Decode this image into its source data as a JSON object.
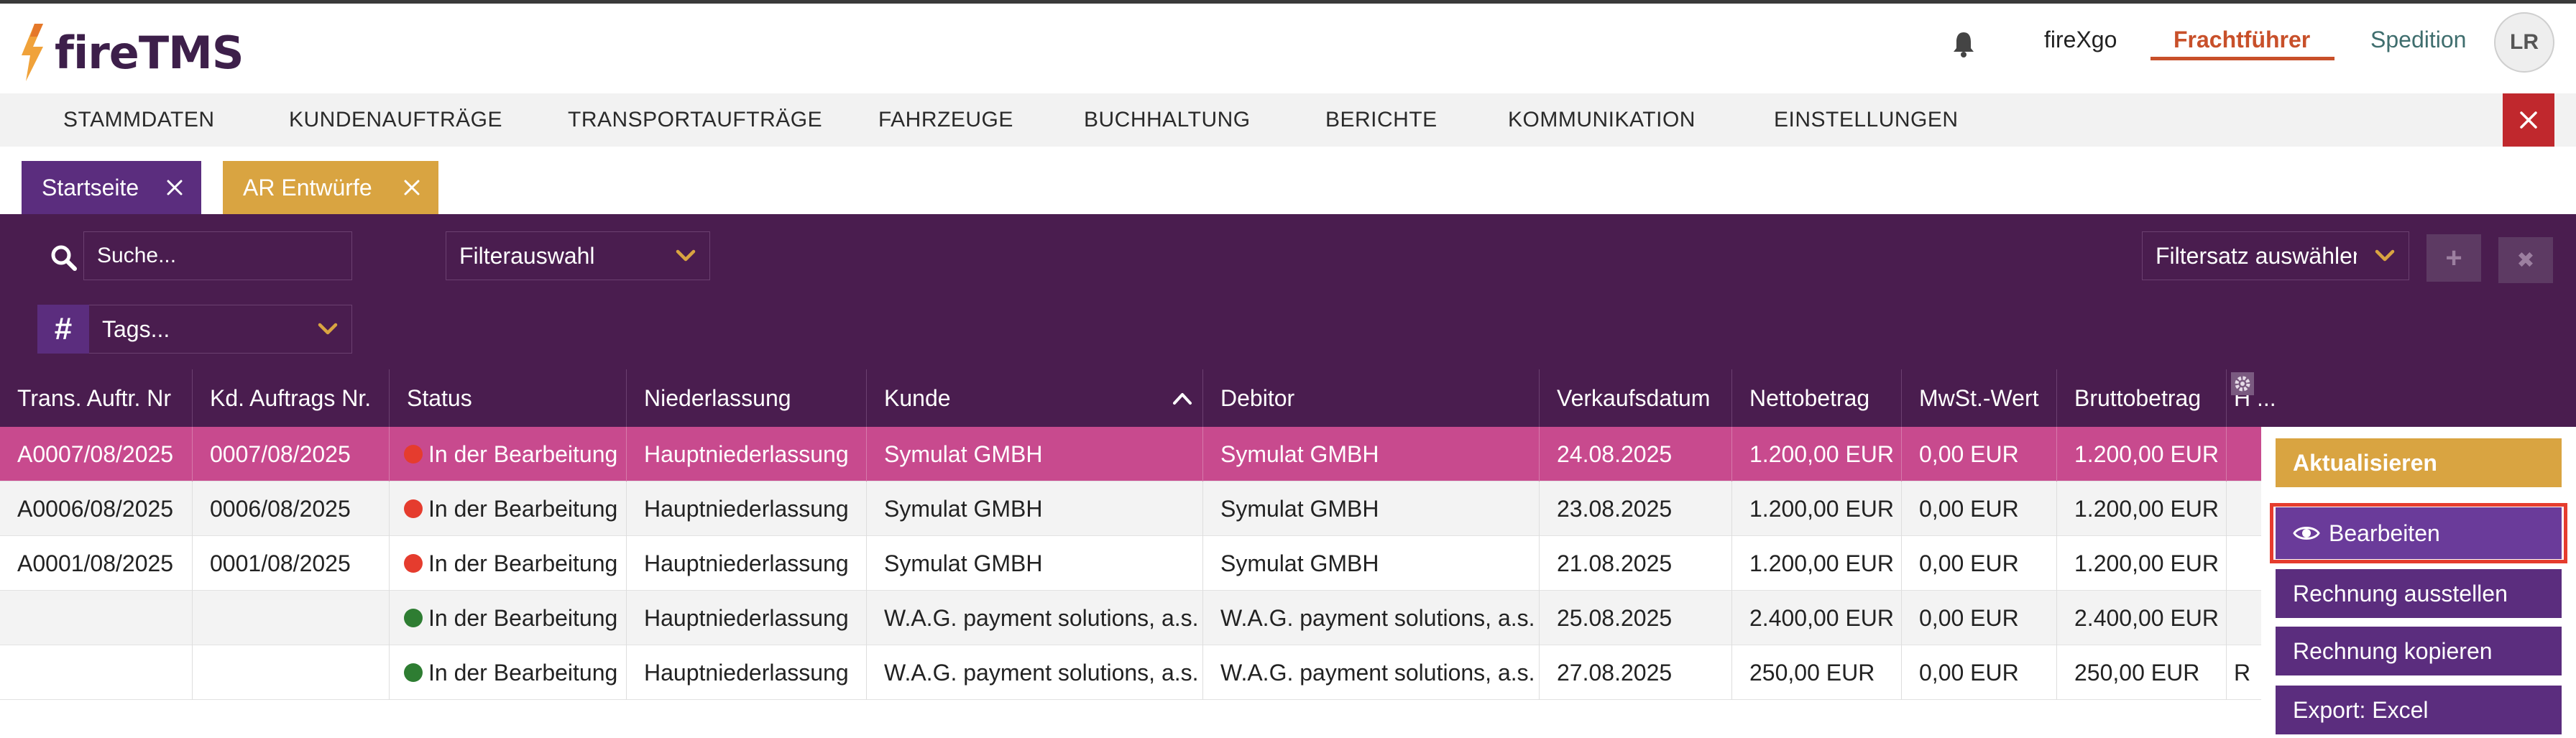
{
  "brand": {
    "name": "fireTMS"
  },
  "header": {
    "links": [
      {
        "label": "fireXgo",
        "active": false
      },
      {
        "label": "Frachtführer",
        "active": true
      },
      {
        "label": "Spedition",
        "active": false
      }
    ],
    "avatar_initials": "LR"
  },
  "nav": {
    "items": [
      "STAMMDATEN",
      "KUNDENAUFTRÄGE",
      "TRANSPORTAUFTRÄGE",
      "FAHRZEUGE",
      "BUCHHALTUNG",
      "BERICHTE",
      "KOMMUNIKATION",
      "EINSTELLUNGEN"
    ]
  },
  "tabs": [
    {
      "label": "Startseite",
      "color": "#5b2d7e"
    },
    {
      "label": "AR Entwürfe",
      "color": "#d9a441"
    }
  ],
  "filters": {
    "search_placeholder": "Suche...",
    "filter_select": "Filterauswahl",
    "filterset_select": "Filtersatz auswählen",
    "tags_icon": "#",
    "tags_select": "Tags...",
    "add_icon": "+",
    "clear_icon": "✖"
  },
  "table": {
    "columns": [
      "Trans. Auftr. Nr",
      "Kd. Auftrags Nr.",
      "Status",
      "Niederlassung",
      "Kunde",
      "Debitor",
      "Verkaufsdatum",
      "Nettobetrag",
      "MwSt.-Wert",
      "Bruttobetrag",
      "H ..."
    ],
    "sorted_column": "Kunde",
    "rows": [
      {
        "trans": "A0007/08/2025",
        "kd": "0007/08/2025",
        "status": "In der Bearbeitung",
        "status_color": "#e53c2e",
        "niederlassung": "Hauptniederlassung",
        "kunde": "Symulat GMBH",
        "debitor": "Symulat GMBH",
        "datum": "24.08.2025",
        "netto": "1.200,00 EUR",
        "mwst": "0,00 EUR",
        "brutto": "1.200,00 EUR",
        "h": ""
      },
      {
        "trans": "A0006/08/2025",
        "kd": "0006/08/2025",
        "status": "In der Bearbeitung",
        "status_color": "#e53c2e",
        "niederlassung": "Hauptniederlassung",
        "kunde": "Symulat GMBH",
        "debitor": "Symulat GMBH",
        "datum": "23.08.2025",
        "netto": "1.200,00 EUR",
        "mwst": "0,00 EUR",
        "brutto": "1.200,00 EUR",
        "h": ""
      },
      {
        "trans": "A0001/08/2025",
        "kd": "0001/08/2025",
        "status": "In der Bearbeitung",
        "status_color": "#e53c2e",
        "niederlassung": "Hauptniederlassung",
        "kunde": "Symulat GMBH",
        "debitor": "Symulat GMBH",
        "datum": "21.08.2025",
        "netto": "1.200,00 EUR",
        "mwst": "0,00 EUR",
        "brutto": "1.200,00 EUR",
        "h": ""
      },
      {
        "trans": "",
        "kd": "",
        "status": "In der Bearbeitung",
        "status_color": "#2e7d32",
        "niederlassung": "Hauptniederlassung",
        "kunde": "W.A.G. payment solutions, a.s.",
        "debitor": "W.A.G. payment solutions, a.s.",
        "datum": "25.08.2025",
        "netto": "2.400,00 EUR",
        "mwst": "0,00 EUR",
        "brutto": "2.400,00 EUR",
        "h": ""
      },
      {
        "trans": "",
        "kd": "",
        "status": "In der Bearbeitung",
        "status_color": "#2e7d32",
        "niederlassung": "Hauptniederlassung",
        "kunde": "W.A.G. payment solutions, a.s.",
        "debitor": "W.A.G. payment solutions, a.s.",
        "datum": "27.08.2025",
        "netto": "250,00 EUR",
        "mwst": "0,00 EUR",
        "brutto": "250,00 EUR",
        "h": "R"
      }
    ]
  },
  "context_menu": {
    "refresh": "Aktualisieren",
    "edit": "Bearbeiten",
    "invoice": "Rechnung ausstellen",
    "copy": "Rechnung kopieren",
    "export": "Export: Excel"
  }
}
